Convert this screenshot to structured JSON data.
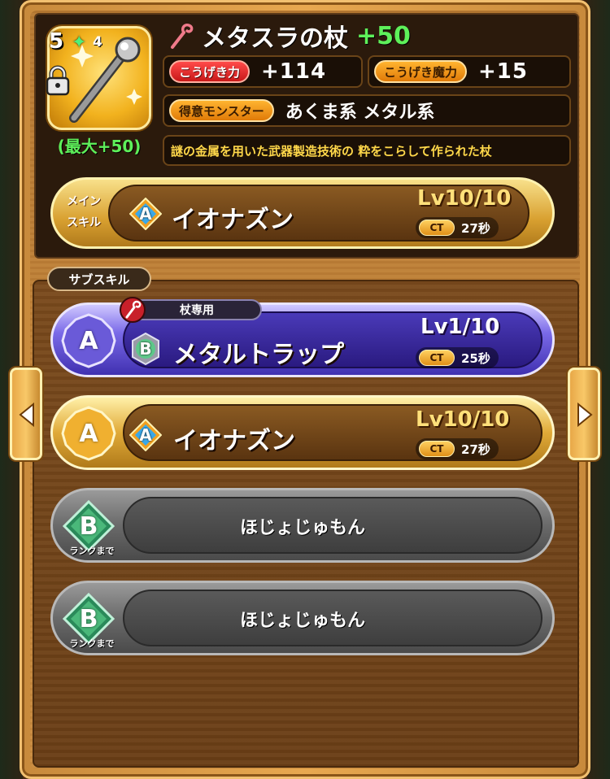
{
  "weapon": {
    "rank_number": "5",
    "star_count": "4",
    "name": "メタスラの杖",
    "plus": "+50",
    "max_plus": "(最大+50)",
    "attack_label": "こうげき力",
    "attack_value": "+114",
    "magic_label": "こうげき魔力",
    "magic_value": "+15",
    "monster_label": "得意モンスター",
    "monster_value": "あくま系 メタル系",
    "description": "謎の金属を用いた武器製造技術の 粋をこらして作られた杖"
  },
  "main_skill": {
    "tag_line1": "メイン",
    "tag_line2": "スキル",
    "rank": "A",
    "name": "イオナズン",
    "level": "Lv10/10",
    "ct_label": "CT",
    "ct_value": "27秒"
  },
  "sub_skill_label": "サブスキル",
  "sub_skills": [
    {
      "slot_rank": "A",
      "exclusive_tag": "杖専用",
      "rank": "B",
      "name": "メタルトラップ",
      "level": "Lv1/10",
      "ct_label": "CT",
      "ct_value": "25秒"
    },
    {
      "slot_rank": "A",
      "rank": "A",
      "name": "イオナズン",
      "level": "Lv10/10",
      "ct_label": "CT",
      "ct_value": "27秒"
    },
    {
      "slot_rank": "B",
      "slot_caption": "ランクまで",
      "name": "ほじょじゅもん"
    },
    {
      "slot_rank": "B",
      "slot_caption": "ランクまで",
      "name": "ほじょじゅもん"
    }
  ],
  "colors": {
    "plus_green": "#5ef05a",
    "level_gold": "#ffe07a",
    "desc_yellow": "#ffd84a",
    "purple_bar": "#7a6ae8",
    "gold_bar": "#e0aa38"
  },
  "icons": {
    "lock": "lock-icon",
    "staff": "staff-icon",
    "prev": "arrow-left-icon",
    "next": "arrow-right-icon"
  }
}
